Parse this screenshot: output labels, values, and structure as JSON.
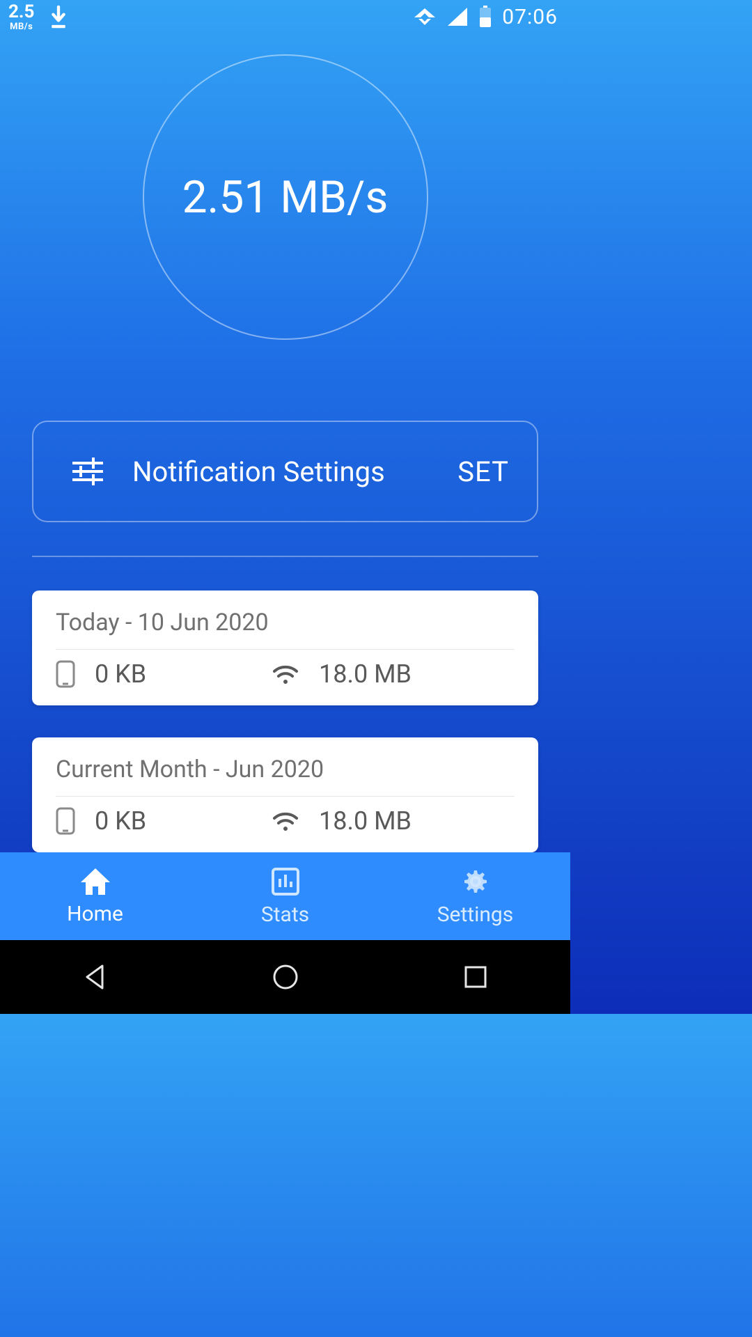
{
  "status_bar": {
    "speed_num": "2.5",
    "speed_unit": "MB/s",
    "clock": "07:06"
  },
  "speed_display": "2.51 MB/s",
  "notification_card": {
    "label": "Notification Settings",
    "action": "SET"
  },
  "cards": [
    {
      "title": "Today - 10 Jun 2020",
      "mobile": "0 KB",
      "wifi": "18.0 MB"
    },
    {
      "title": "Current Month - Jun 2020",
      "mobile": "0 KB",
      "wifi": "18.0 MB"
    }
  ],
  "tabs": {
    "home": "Home",
    "stats": "Stats",
    "settings": "Settings"
  }
}
